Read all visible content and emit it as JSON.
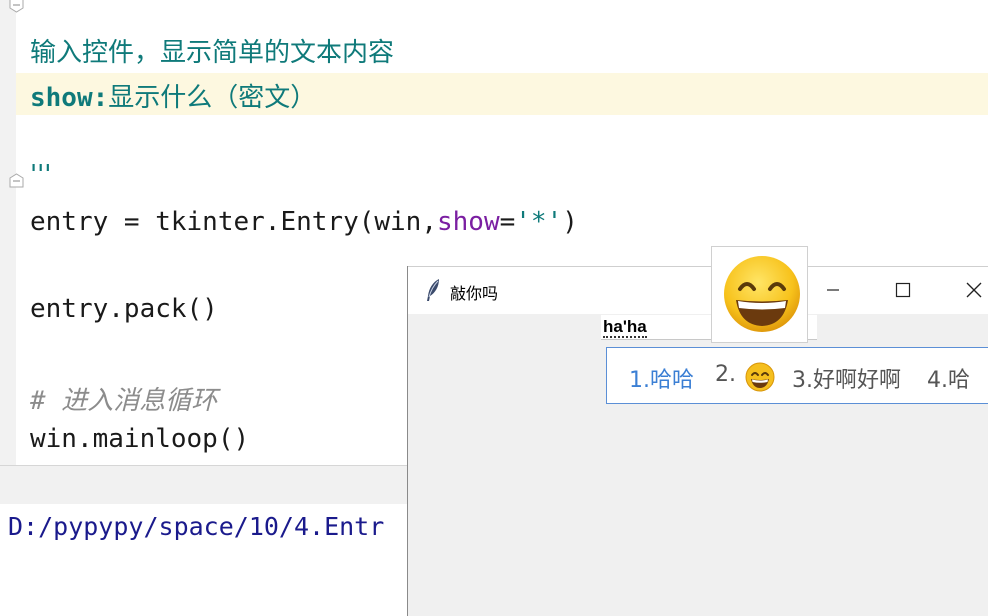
{
  "editor": {
    "line_quotes_top": "'''",
    "doc_line1": "输入控件，显示简单的文本内容",
    "doc_line2_key": "show:",
    "doc_line2_text": "显示什么（密文）",
    "line_quotes_bottom": "'''",
    "code_entry_prefix": "entry = tkinter.Entry(win,",
    "code_entry_kw": "show",
    "code_entry_eq": "=",
    "code_entry_str": "'*'",
    "code_entry_close": ")",
    "code_pack": "entry.pack()",
    "code_comment": "# 进入消息循环",
    "code_mainloop": "win.mainloop()"
  },
  "console": {
    "output_line": "D:/pypypy/space/10/4.Entr"
  },
  "tk_window": {
    "title": "敲你吗",
    "entry_value": "ha'ha",
    "icon": "feather-icon"
  },
  "ime": {
    "candidates": [
      {
        "index": "1.",
        "text": "哈哈"
      },
      {
        "index": "2.",
        "text": "",
        "emoji": "grinning-face"
      },
      {
        "index": "3.",
        "text": "好啊好啊"
      },
      {
        "index": "4.",
        "text": "哈"
      }
    ]
  },
  "colors": {
    "docstring": "#0f7a7a",
    "keyword": "#7b1fa2",
    "highlight_line": "#fdf8e0",
    "ime_accent": "#3b7fd4"
  }
}
